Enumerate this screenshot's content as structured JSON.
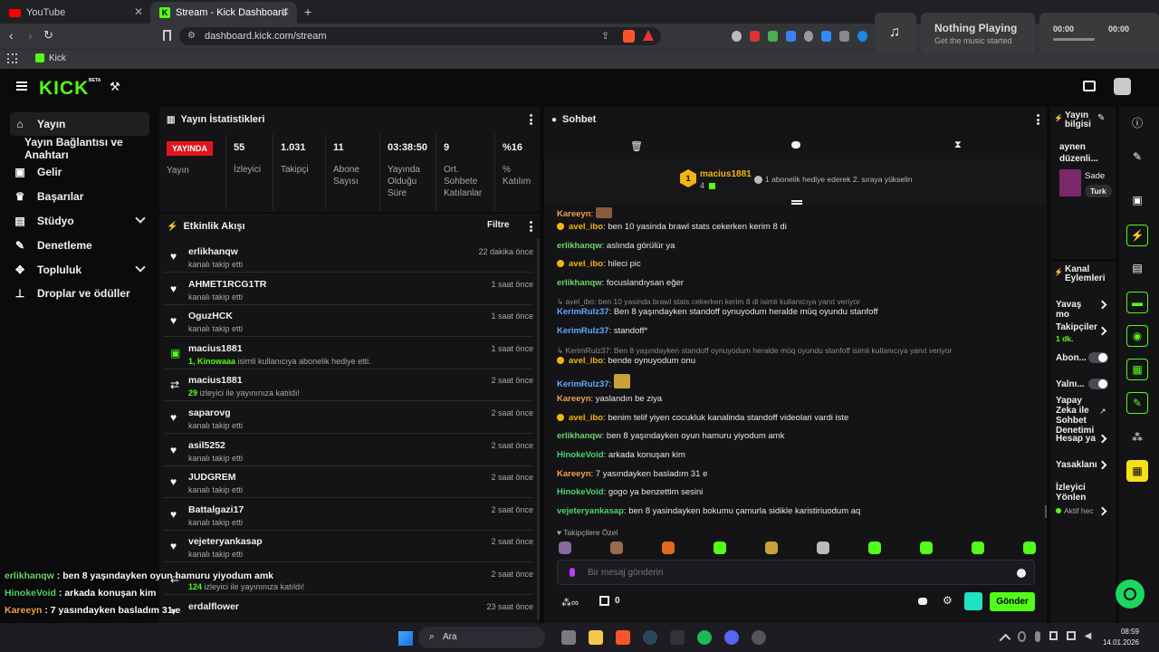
{
  "browser": {
    "tabs": [
      {
        "title": "YouTube",
        "active": false
      },
      {
        "title": "Stream - Kick Dashboard",
        "active": true
      }
    ],
    "url": "dashboard.kick.com/stream",
    "bookmark": "Kick"
  },
  "media": {
    "title": "Nothing Playing",
    "subtitle": "Get the music started",
    "time_start": "00:00",
    "time_end": "00:00"
  },
  "brand": {
    "logo": "KICK",
    "badge": "BETA",
    "accent": "#53fc18"
  },
  "sidebar": {
    "items": [
      {
        "label": "Yayın",
        "icon": "home-icon",
        "active": true
      },
      {
        "label": "Yayın Bağlantısı ve Anahtarı",
        "icon": "",
        "active": false
      },
      {
        "label": "Gelir",
        "icon": "revenue-icon",
        "active": false
      },
      {
        "label": "Başarılar",
        "icon": "trophy-icon",
        "active": false
      },
      {
        "label": "Stüdyo",
        "icon": "studio-icon",
        "active": false
      },
      {
        "label": "Denetleme",
        "icon": "wrench-icon",
        "active": false
      },
      {
        "label": "Topluluk",
        "icon": "community-icon",
        "active": false
      },
      {
        "label": "Droplar ve ödüller",
        "icon": "drops-icon",
        "active": false
      }
    ]
  },
  "stats": {
    "title": "Yayın İstatistikleri",
    "live_badge": "YAYINDA",
    "live_label": "Yayın",
    "cells": [
      {
        "value": "55",
        "label": "İzleyici"
      },
      {
        "value": "1.031",
        "label": "Takipçi"
      },
      {
        "value": "11",
        "label": "Abone Sayısı"
      },
      {
        "value": "03:38:50",
        "label": "Yayında Olduğu Süre"
      },
      {
        "value": "9",
        "label": "Ort. Sohbete Katılanlar"
      },
      {
        "value": "%16",
        "label": "% Katılım"
      }
    ]
  },
  "activity": {
    "title": "Etkinlik Akışı",
    "filter": "Filtre",
    "events": [
      {
        "name": "erlikhanqw",
        "pre": "",
        "sub": "kanalı takip etti",
        "time": "22 dakika önce",
        "icon": "heart-icon"
      },
      {
        "name": "AHMET1RCG1TR",
        "pre": "",
        "sub": "kanalı takip etti",
        "time": "1 saat önce",
        "icon": "heart-icon"
      },
      {
        "name": "OguzHCK",
        "pre": "",
        "sub": "kanalı takip etti",
        "time": "1 saat önce",
        "icon": "heart-icon"
      },
      {
        "name": "macius1881",
        "pre": "1, Kinowaaa",
        "sub": " isimli kullanıcıya abonelik hediye etti.",
        "time": "1 saat önce",
        "icon": "gift-icon"
      },
      {
        "name": "macius1881",
        "pre": "29",
        "sub": " izleyici ile yayınınıza katıldı!",
        "time": "2 saat önce",
        "icon": "raid-icon"
      },
      {
        "name": "saparovg",
        "pre": "",
        "sub": "kanalı takip etti",
        "time": "2 saat önce",
        "icon": "heart-icon"
      },
      {
        "name": "asil5252",
        "pre": "",
        "sub": "kanalı takip etti",
        "time": "2 saat önce",
        "icon": "heart-icon"
      },
      {
        "name": "JUDGREM",
        "pre": "",
        "sub": "kanalı takip etti",
        "time": "2 saat önce",
        "icon": "heart-icon"
      },
      {
        "name": "Battalgazi17",
        "pre": "",
        "sub": "kanalı takip etti",
        "time": "2 saat önce",
        "icon": "heart-icon"
      },
      {
        "name": "vejeteryankasap",
        "pre": "",
        "sub": "kanalı takip etti",
        "time": "2 saat önce",
        "icon": "heart-icon"
      },
      {
        "name": "",
        "pre": "124",
        "sub": " izleyici ile yayınınıza katıldı!",
        "time": "2 saat önce",
        "icon": "raid-icon"
      },
      {
        "name": "erdalflower",
        "pre": "",
        "sub": "",
        "time": "23 saat önce",
        "icon": "heart-icon"
      }
    ]
  },
  "chat": {
    "title": "Sohbet",
    "pinned_user": "macius1881",
    "pinned_count": "4",
    "pinned_rank": "1",
    "pinned_note": "1 abonelik hediye ederek 2. sıraya yükselin",
    "messages": [
      {
        "kind": "msg",
        "user": "Kareeyn",
        "color": "#f0a24b",
        "text": "",
        "dot": false
      },
      {
        "kind": "msg",
        "user": "avel_ibo",
        "color": "#f5b50f",
        "text": "ben 10 yasinda brawl stats cekerken kerim 8 di",
        "dot": true
      },
      {
        "kind": "msg",
        "user": "erlikhanqw",
        "color": "#6fd46a",
        "text": "aslında görülür ya",
        "dot": false
      },
      {
        "kind": "msg",
        "user": "avel_ibo",
        "color": "#f5b50f",
        "text": "hileci pic",
        "dot": true
      },
      {
        "kind": "msg",
        "user": "erlikhanqw",
        "color": "#6fd46a",
        "text": "focuslandıysan eğer",
        "dot": false
      },
      {
        "kind": "reply",
        "text": "avel_ibo: ben 10 yasinda brawl stats cekerken kerim 8 di isimli kullanıcıya yanıt veriyor"
      },
      {
        "kind": "msg",
        "user": "KerimRulz37",
        "color": "#63a8ff",
        "text": "Ben 8 yaşındayken standoff oynuyodum heralde müq oyundu stanfoff",
        "dot": false
      },
      {
        "kind": "msg",
        "user": "KerimRulz37",
        "color": "#63a8ff",
        "text": "standoff*",
        "dot": false
      },
      {
        "kind": "reply",
        "text": "KerimRulz37: Ben 8 yaşındayken standoff oynuyodum heralde müq oyundu stanfoff isimli kullanıcıya yanıt veriyor"
      },
      {
        "kind": "msg",
        "user": "avel_ibo",
        "color": "#f5b50f",
        "text": "bende oynuyodum onu",
        "dot": true
      },
      {
        "kind": "msg",
        "user": "KerimRulz37",
        "color": "#63a8ff",
        "text": "",
        "dot": false
      },
      {
        "kind": "msg",
        "user": "Kareeyn",
        "color": "#f0a24b",
        "text": "yaslandın be ziya",
        "dot": false
      },
      {
        "kind": "msg",
        "user": "avel_ibo",
        "color": "#f5b50f",
        "text": "benim telif yiyen cocukluk kanalinda standoff videolari vardi iste",
        "dot": true
      },
      {
        "kind": "msg",
        "user": "erlikhanqw",
        "color": "#6fd46a",
        "text": "ben 8 yaşındayken oyun hamuru yiyodum amk",
        "dot": false
      },
      {
        "kind": "msg",
        "user": "HinokeVoid",
        "color": "#4fd36b",
        "text": "arkada konuşan kim",
        "dot": false
      },
      {
        "kind": "msg",
        "user": "Kareeyn",
        "color": "#f0a24b",
        "text": "7 yasındayken basladım 31 e",
        "dot": false
      },
      {
        "kind": "msg",
        "user": "HinokeVoid",
        "color": "#4fd36b",
        "text": "gogo ya benzettim sesini",
        "dot": false
      },
      {
        "kind": "msg",
        "user": "vejeteryankasap",
        "color": "#4fd36b",
        "text": "ben 8 yasindayken bokumu çamurla sidikle karistiriuodum aq",
        "dot": false
      }
    ],
    "emote_label": "Takipçilere Özel",
    "input_placeholder": "Bir mesaj gönderin",
    "point_count": "0",
    "send_label": "Gönder"
  },
  "stream_info": {
    "title": "Yayın bilgisi",
    "edit_label": "aynen düzenli...",
    "category": "Sade",
    "tag": "Turk"
  },
  "channel_actions": {
    "title": "Kanal Eylemleri",
    "items": [
      {
        "label": "Yavaş mo",
        "type": "chevron"
      },
      {
        "label": "Takipçiler",
        "sub": "1 dk.",
        "type": "chevron"
      },
      {
        "label": "Abon...",
        "type": "toggle"
      },
      {
        "label": "Yalnı...",
        "type": "toggle"
      },
      {
        "label": "Yapay Zeka ile Sohbet Denetimi",
        "type": "link"
      },
      {
        "label": "Hesap ya",
        "type": "chevron"
      },
      {
        "label": "Yasaklanı",
        "type": "chevron"
      },
      {
        "label": "İzleyici Yönlen",
        "type": "none"
      },
      {
        "label": "Aktif hec",
        "type": "chevron"
      }
    ]
  },
  "overlay_chat": [
    {
      "user": "erlikhanqw",
      "color": "#6fd46a",
      "text": " : ben 8 yaşındayken oyun hamuru yiyodum amk"
    },
    {
      "user": "HinokeVoid",
      "color": "#4fd36b",
      "text": " : arkada konuşan kim"
    },
    {
      "user": "Kareeyn",
      "color": "#f0a24b",
      "text": " : 7 yasındayken basladım 31 e"
    },
    {
      "user": "HinokeVoid",
      "color": "#4fd36b",
      "text": " : gogo ya benzettim sesini"
    },
    {
      "user": "vejeteryankasap",
      "color": "#4fd36b",
      "text": " : ben 8 yasindayken bokumu çamurla sidikle karistiriuodum aq"
    }
  ],
  "taskbar": {
    "search": "Ara",
    "time": "08:59",
    "date": "14.01.2026"
  }
}
